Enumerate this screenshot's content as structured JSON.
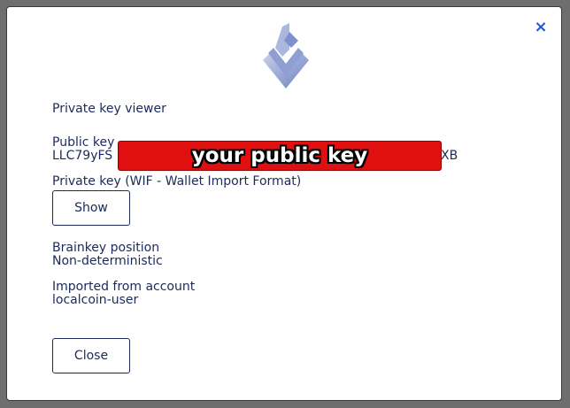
{
  "modal": {
    "close_icon": "close-icon",
    "close_glyph": "×",
    "heading": "Private key viewer",
    "public_key_label": "Public key",
    "public_key_prefix": "LLC79yFS",
    "public_key_suffix": "dXB",
    "redaction_text": "your public key",
    "private_key_label": "Private key (WIF - Wallet Import Format)",
    "show_button": "Show",
    "brainkey_label": "Brainkey position",
    "brainkey_value": "Non-deterministic",
    "imported_label": "Imported from account",
    "imported_value": "localcoin-user",
    "close_button": "Close"
  },
  "colors": {
    "text": "#1b2a5a",
    "accent": "#1e5bd0",
    "redaction": "#e01010"
  }
}
